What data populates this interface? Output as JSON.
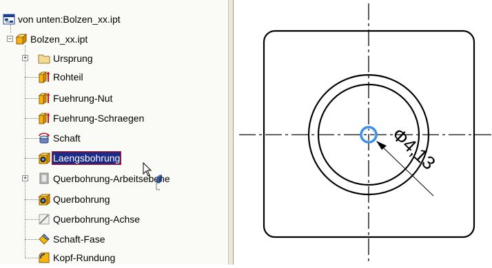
{
  "browser": {
    "root_label": "von unten:Bolzen_xx.ipt",
    "part_label": "Bolzen_xx.ipt",
    "items": [
      {
        "label": "Ursprung",
        "icon": "folder-icon",
        "expandable": true
      },
      {
        "label": "Rohteil",
        "icon": "extrusion-feature-icon",
        "expandable": false
      },
      {
        "label": "Fuehrung-Nut",
        "icon": "extrusion-feature-icon",
        "expandable": false
      },
      {
        "label": "Fuehrung-Schraegen",
        "icon": "extrusion-feature-icon",
        "expandable": false
      },
      {
        "label": "Schaft",
        "icon": "revolve-feature-icon",
        "expandable": false
      },
      {
        "label": "Laengsbohrung",
        "icon": "hole-feature-icon",
        "expandable": false,
        "selected": true
      },
      {
        "label": "Querbohrung-Arbeitsebene",
        "icon": "work-plane-icon",
        "expandable": true
      },
      {
        "label": "Querbohrung",
        "icon": "hole-feature-icon",
        "expandable": false
      },
      {
        "label": "Querbohrung-Achse",
        "icon": "work-axis-icon",
        "expandable": false
      },
      {
        "label": "Schaft-Fase",
        "icon": "chamfer-feature-icon",
        "expandable": false
      },
      {
        "label": "Kopf-Rundung",
        "icon": "fillet-feature-icon",
        "expandable": false
      }
    ]
  },
  "canvas": {
    "dimension_label": "Φ4,13",
    "highlight_color": "#3a8ee6"
  }
}
